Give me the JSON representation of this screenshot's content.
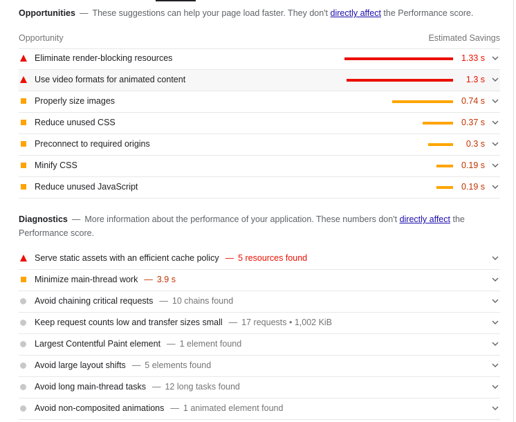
{
  "opportunities": {
    "title": "Opportunities",
    "desc_before": "These suggestions can help your page load faster. They don't",
    "link": "directly affect",
    "desc_after": "the Performance score.",
    "col_left": "Opportunity",
    "col_right": "Estimated Savings",
    "items": [
      {
        "label": "Eliminate render-blocking resources",
        "saving": "1.33 s",
        "status": "fail",
        "bar_fraction": 1.0
      },
      {
        "label": "Use video formats for animated content",
        "saving": "1.3 s",
        "status": "fail",
        "bar_fraction": 0.98
      },
      {
        "label": "Properly size images",
        "saving": "0.74 s",
        "status": "average",
        "bar_fraction": 0.56
      },
      {
        "label": "Reduce unused CSS",
        "saving": "0.37 s",
        "status": "average",
        "bar_fraction": 0.28
      },
      {
        "label": "Preconnect to required origins",
        "saving": "0.3 s",
        "status": "average",
        "bar_fraction": 0.23
      },
      {
        "label": "Minify CSS",
        "saving": "0.19 s",
        "status": "average",
        "bar_fraction": 0.15
      },
      {
        "label": "Reduce unused JavaScript",
        "saving": "0.19 s",
        "status": "average",
        "bar_fraction": 0.15
      }
    ]
  },
  "diagnostics": {
    "title": "Diagnostics",
    "desc_before": "More information about the performance of your application. These numbers don't",
    "link": "directly affect",
    "desc_after": "the Performance score.",
    "items": [
      {
        "label": "Serve static assets with an efficient cache policy",
        "display": "5 resources found",
        "status": "fail"
      },
      {
        "label": "Minimize main-thread work",
        "display": "3.9 s",
        "status": "average"
      },
      {
        "label": "Avoid chaining critical requests",
        "display": "10 chains found",
        "status": "info"
      },
      {
        "label": "Keep request counts low and transfer sizes small",
        "display": "17 requests • 1,002 KiB",
        "status": "info"
      },
      {
        "label": "Largest Contentful Paint element",
        "display": "1 element found",
        "status": "info"
      },
      {
        "label": "Avoid large layout shifts",
        "display": "5 elements found",
        "status": "info"
      },
      {
        "label": "Avoid long main-thread tasks",
        "display": "12 long tasks found",
        "status": "info"
      },
      {
        "label": "Avoid non-composited animations",
        "display": "1 animated element found",
        "status": "info"
      }
    ]
  },
  "colors": {
    "fail": "#eb0f00",
    "average": "#ffa400",
    "info": "#c8c8c8",
    "link": "#1a0dab"
  },
  "icons": {
    "fail": "red-triangle-icon",
    "average": "orange-square-icon",
    "info": "gray-circle-icon",
    "expand": "chevron-down-icon"
  }
}
